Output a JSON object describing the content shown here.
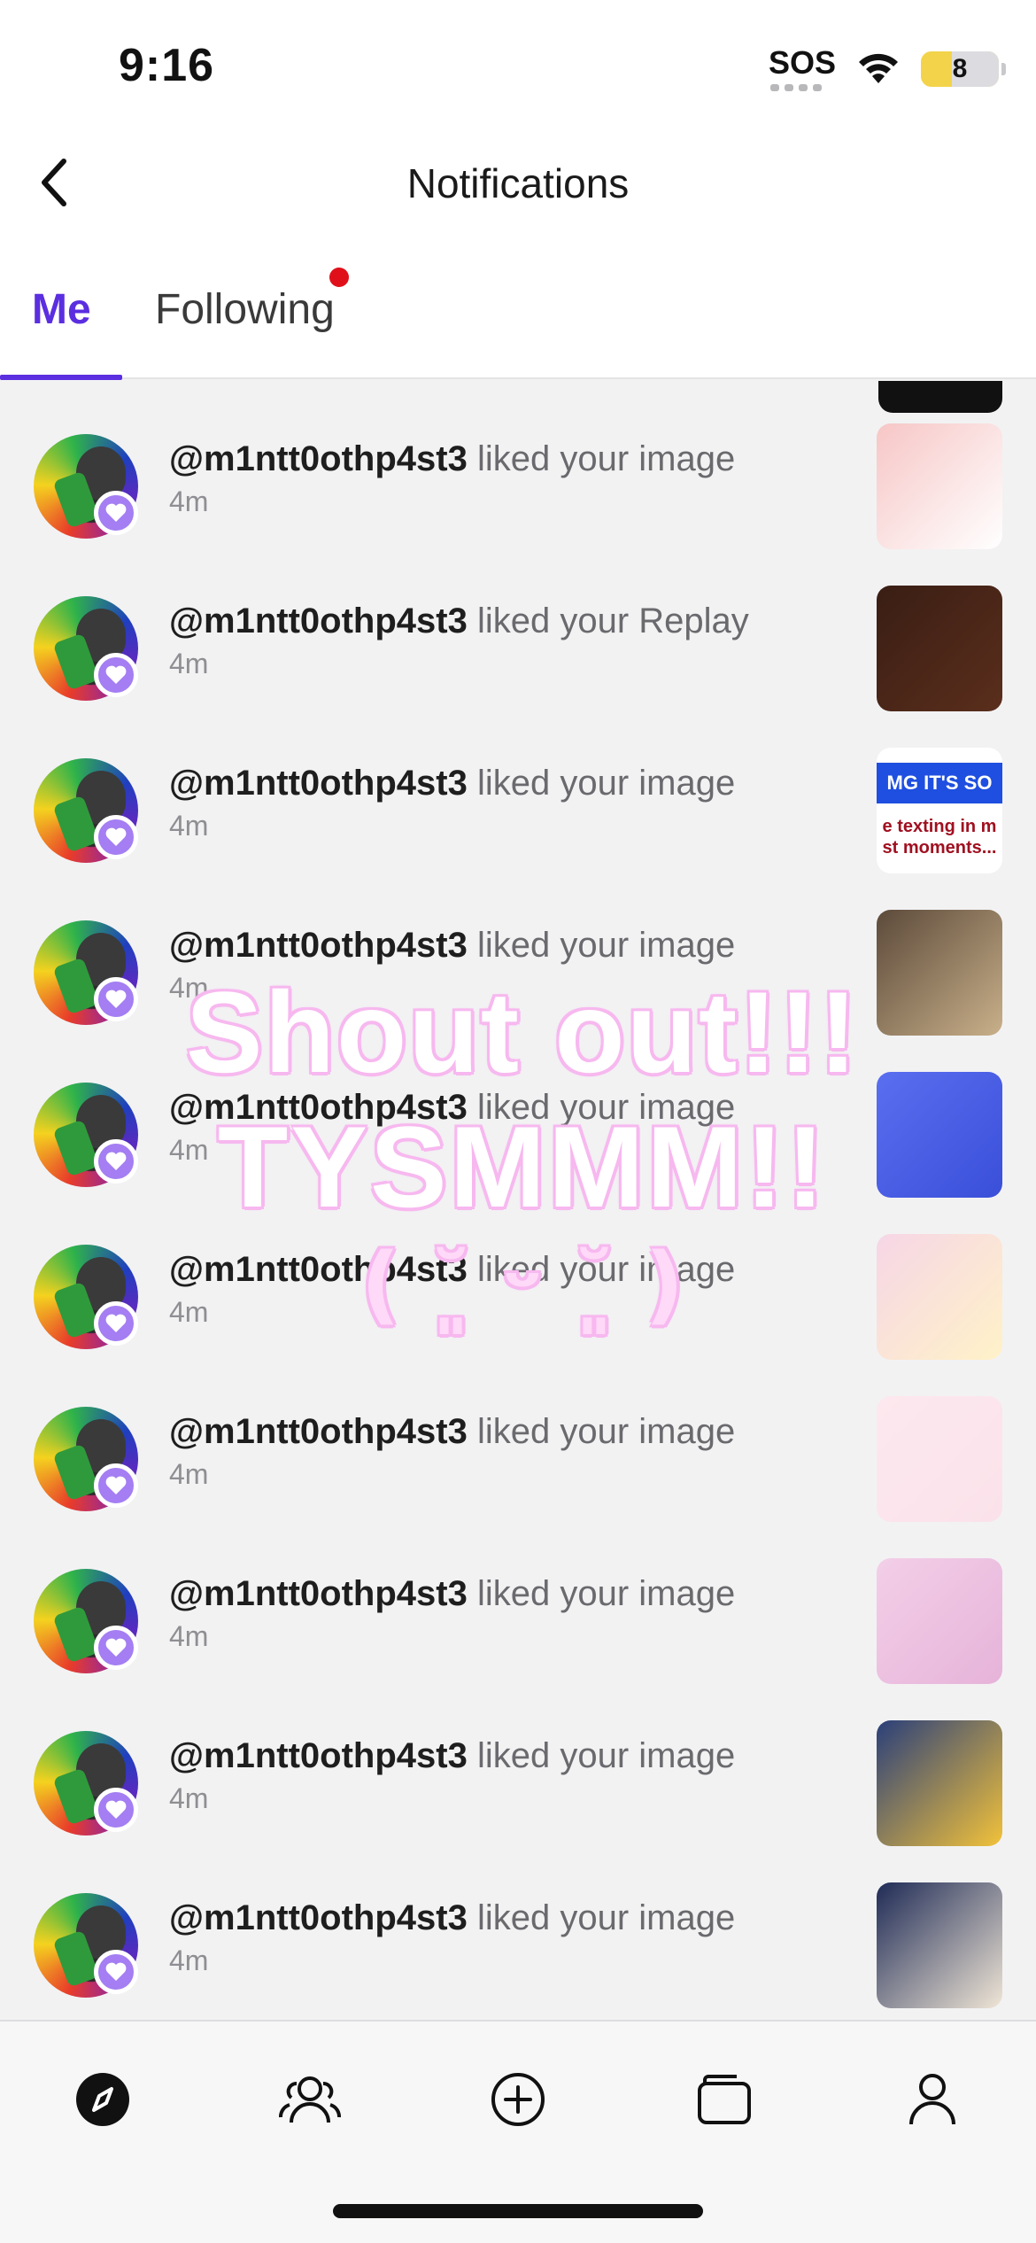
{
  "status_bar": {
    "time": "9:16",
    "sos": "SOS",
    "battery": "8",
    "battery_level": 0.4
  },
  "header": {
    "title": "Notifications"
  },
  "tabs": [
    {
      "label": "Me",
      "active": true
    },
    {
      "label": "Following",
      "active": false,
      "has_dot": true
    }
  ],
  "notifications": [
    {
      "user": "@m1ntt0othp4st3",
      "action": "liked your image",
      "time": "4m",
      "thumb_colors": [
        "#f7c6c6",
        "#ffffff"
      ],
      "thumb_lines": []
    },
    {
      "user": "@m1ntt0othp4st3",
      "action": "liked your Replay",
      "time": "4m",
      "thumb_colors": [
        "#3a1e14",
        "#5a2e1c"
      ],
      "thumb_lines": []
    },
    {
      "user": "@m1ntt0othp4st3",
      "action": "liked your image",
      "time": "4m",
      "thumb_colors": [
        "#ffffff",
        "#ffffff"
      ],
      "thumb_lines": [
        "MG IT'S SO",
        "e texting in m",
        "st moments..."
      ]
    },
    {
      "user": "@m1ntt0othp4st3",
      "action": "liked your image",
      "time": "4m",
      "thumb_colors": [
        "#5c4a3a",
        "#c9b08a"
      ],
      "thumb_lines": []
    },
    {
      "user": "@m1ntt0othp4st3",
      "action": "liked your image",
      "time": "4m",
      "thumb_colors": [
        "#5a6ef0",
        "#3a4fd9"
      ],
      "thumb_lines": []
    },
    {
      "user": "@m1ntt0othp4st3",
      "action": "liked your image",
      "time": "4m",
      "thumb_colors": [
        "#f6d6e6",
        "#fff2c8"
      ],
      "thumb_lines": []
    },
    {
      "user": "@m1ntt0othp4st3",
      "action": "liked your image",
      "time": "4m",
      "thumb_colors": [
        "#fde8ef",
        "#fbe2ea"
      ],
      "thumb_lines": []
    },
    {
      "user": "@m1ntt0othp4st3",
      "action": "liked your image",
      "time": "4m",
      "thumb_colors": [
        "#f3cfe8",
        "#e6b3d9"
      ],
      "thumb_lines": []
    },
    {
      "user": "@m1ntt0othp4st3",
      "action": "liked your image",
      "time": "4m",
      "thumb_colors": [
        "#2a3f7a",
        "#f2c23a"
      ],
      "thumb_lines": []
    },
    {
      "user": "@m1ntt0othp4st3",
      "action": "liked your image",
      "time": "4m",
      "thumb_colors": [
        "#1f2b56",
        "#f0e6d6"
      ],
      "thumb_lines": []
    }
  ],
  "overlay": {
    "line1": "Shout out!!!",
    "line2": "TYSMMM!!",
    "line3": "( ˘͈ ᵕ ˘͈ )"
  },
  "bottom_nav": [
    {
      "icon": "compass-icon",
      "active": true
    },
    {
      "icon": "people-icon",
      "active": false
    },
    {
      "icon": "plus-circle-icon",
      "active": false
    },
    {
      "icon": "folder-icon",
      "active": false
    },
    {
      "icon": "profile-icon",
      "active": false
    }
  ],
  "colors": {
    "accent": "#5b2ee0",
    "badge": "#a47ef2",
    "dot": "#e0101a",
    "overlay_glow": "#f7b8ef"
  }
}
